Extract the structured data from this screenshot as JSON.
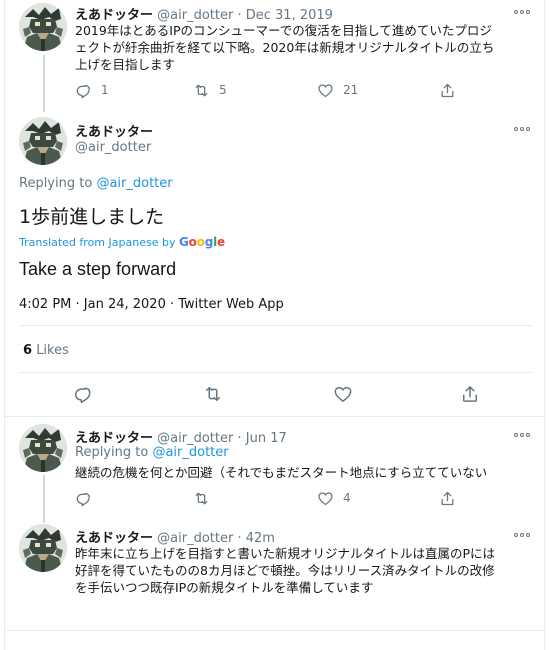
{
  "tweet1": {
    "name": "えあドッター",
    "handle": "@air_dotter",
    "sep": "·",
    "date": "Dec 31, 2019",
    "lines": [
      "2019年はとあるIPのコンシューマーでの復活を目指して進めていたプロジ",
      "ェクトが紆余曲折を経て以下略。2020年は新規オリジナルタイトルの立ち",
      "上げを目指します"
    ],
    "reply_count": "1",
    "retweet_count": "5",
    "like_count": "21"
  },
  "main": {
    "name": "えあドッター",
    "handle": "@air_dotter",
    "replying_prefix": "Replying to",
    "replying_handle": "@air_dotter",
    "text": "1歩前進しました",
    "translated_from": "Translated from Japanese by",
    "google_letters": [
      "G",
      "o",
      "o",
      "g",
      "l",
      "e"
    ],
    "translation": "Take a step forward",
    "timestamp": "4:02 PM · Jan 24, 2020 · Twitter Web App",
    "likes_count": "6",
    "likes_label": "Likes"
  },
  "reply1": {
    "name": "えあドッター",
    "handle": "@air_dotter",
    "sep": "·",
    "date": "Jun 17",
    "replying_prefix": "Replying to",
    "replying_handle": "@air_dotter",
    "text": "継続の危機を何とか回避（それでもまだスタート地点にすら立てていない",
    "like_count": "4"
  },
  "reply2": {
    "name": "えあドッター",
    "handle": "@air_dotter",
    "sep": "·",
    "date": "42m",
    "lines": [
      "昨年末に立ち上げを目指すと書いた新規オリジナルタイトルは直属のPには",
      "好評を得ていたものの8カ月ほどで頓挫。今はリリース済みタイトルの改修",
      "を手伝いつつ既存IPの新規タイトルを準備しています"
    ]
  },
  "colors": {
    "accent": "#1b95e0",
    "text": "#14171a",
    "secondary": "#657786",
    "border": "#e6ecf0",
    "google_blue": "#4285f4",
    "google_red": "#ea4335",
    "google_yellow": "#fbbc05",
    "google_green": "#34a853"
  },
  "icons": [
    "reply-icon",
    "retweet-icon",
    "like-icon",
    "share-icon",
    "more-icon",
    "avatar"
  ]
}
